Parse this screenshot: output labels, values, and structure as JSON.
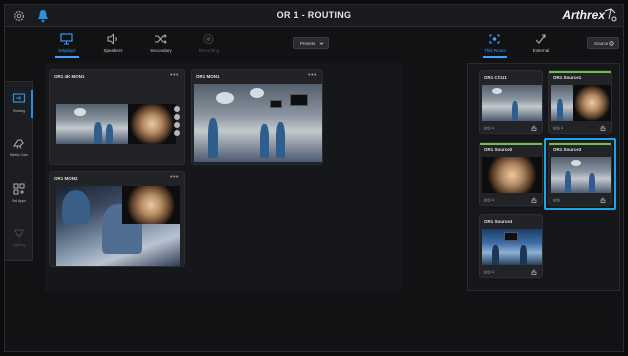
{
  "header": {
    "title": "OR 1 - ROUTING",
    "brand": "Arthrex"
  },
  "sidebar": {
    "items": [
      {
        "label": "Routing",
        "icon": "routing-icon",
        "active": true
      },
      {
        "label": "Metric Cam",
        "icon": "camera-icon",
        "active": false
      },
      {
        "label": "Set Apps",
        "icon": "apps-icon",
        "active": false
      },
      {
        "label": "Lighting",
        "icon": "lighting-icon",
        "active": false,
        "disabled": true
      }
    ]
  },
  "tabs": [
    {
      "label": "Displays",
      "icon": "monitor-icon",
      "active": true
    },
    {
      "label": "Speakers",
      "icon": "speaker-icon",
      "active": false
    },
    {
      "label": "Secondary",
      "icon": "shuffle-icon",
      "active": false
    },
    {
      "label": "Recording",
      "icon": "record-icon",
      "active": false,
      "disabled": true
    }
  ],
  "presets_label": "Presets",
  "right_tabs": [
    {
      "label": "This Room",
      "icon": "room-icon",
      "active": true
    },
    {
      "label": "External",
      "icon": "external-icon",
      "active": false
    }
  ],
  "source_label": "Source",
  "displays": [
    {
      "name": "OR1 4K MON1",
      "menu": "•••"
    },
    {
      "name": "OR1 MON1",
      "menu": "•••"
    },
    {
      "name": "OR1 MON2",
      "menu": "•••"
    }
  ],
  "sources": [
    {
      "name": "OR1 CCU1",
      "footer": "((•)) 1"
    },
    {
      "name": "OR1 Source1",
      "footer": "((•)) 1"
    },
    {
      "name": "OR1 Source2",
      "footer": "((•)) 1"
    },
    {
      "name": "OR1 Source3",
      "footer": "((•))"
    },
    {
      "name": "OR1 Source4",
      "footer": "((•)) 1"
    }
  ],
  "colors": {
    "accent": "#3ea0ff",
    "selected": "#1fa3e6",
    "active_signal": "#6cc04a",
    "background": "#111214"
  }
}
